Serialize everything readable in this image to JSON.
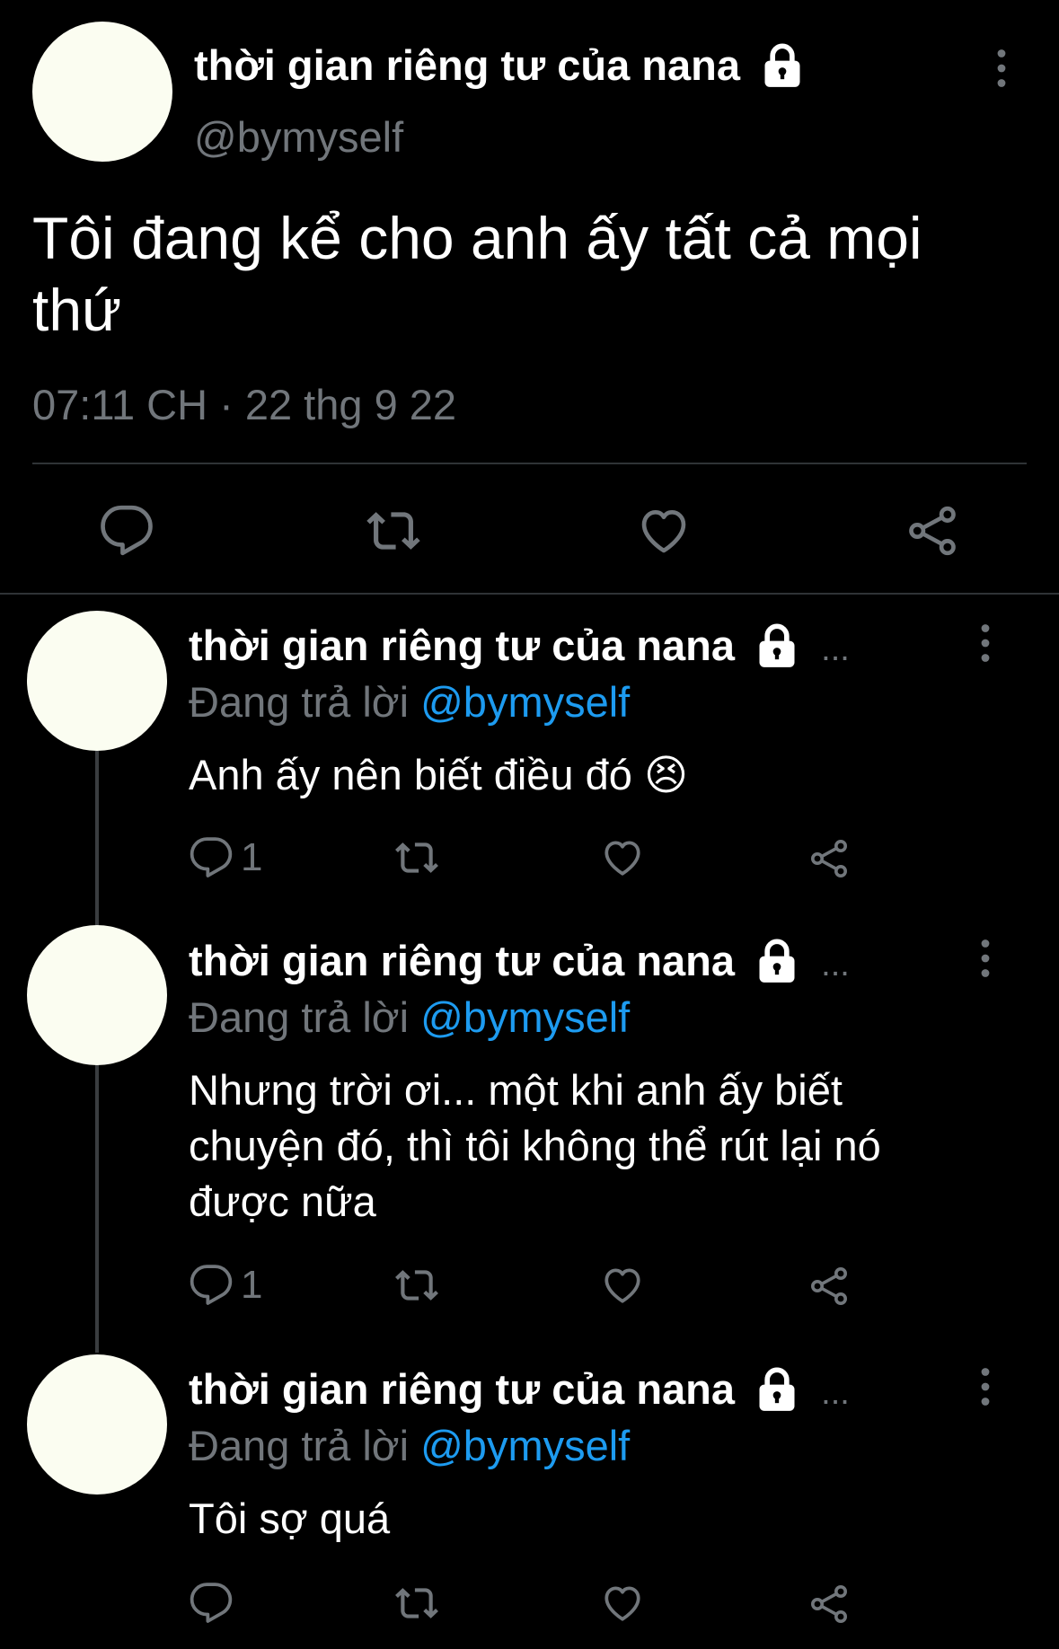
{
  "main_tweet": {
    "author_name": "thời gian riêng tư của nana",
    "handle": "@bymyself",
    "text": "Tôi đang kể cho anh ấy tất cả mọi thứ",
    "timestamp": "07:11 CH · 22 thg 9 22"
  },
  "replies": [
    {
      "author_name": "thời gian riêng tư của nana",
      "ellipsis": "...",
      "replying_prefix": "Đang trả lời",
      "replying_to": "@bymyself",
      "text": "Anh ấy nên biết điều đó 😣",
      "reply_count": "1"
    },
    {
      "author_name": "thời gian riêng tư của nana",
      "ellipsis": "...",
      "replying_prefix": "Đang trả lời",
      "replying_to": "@bymyself",
      "text": "Nhưng trời ơi... một khi anh ấy biết chuyện đó, thì tôi không thể rút lại nó được nữa",
      "reply_count": "1"
    },
    {
      "author_name": "thời gian riêng tư của nana",
      "ellipsis": "...",
      "replying_prefix": "Đang trả lời",
      "replying_to": "@bymyself",
      "text": "Tôi sợ quá",
      "reply_count": ""
    }
  ],
  "icons": {
    "lock": "lock-icon",
    "more": "more-vertical-icon",
    "reply": "reply-icon",
    "retweet": "retweet-icon",
    "like": "heart-icon",
    "share": "share-icon"
  },
  "colors": {
    "background": "#000000",
    "text": "#ffffff",
    "muted": "#71767b",
    "link": "#1d9bf0",
    "avatar": "#fbfdf1"
  }
}
